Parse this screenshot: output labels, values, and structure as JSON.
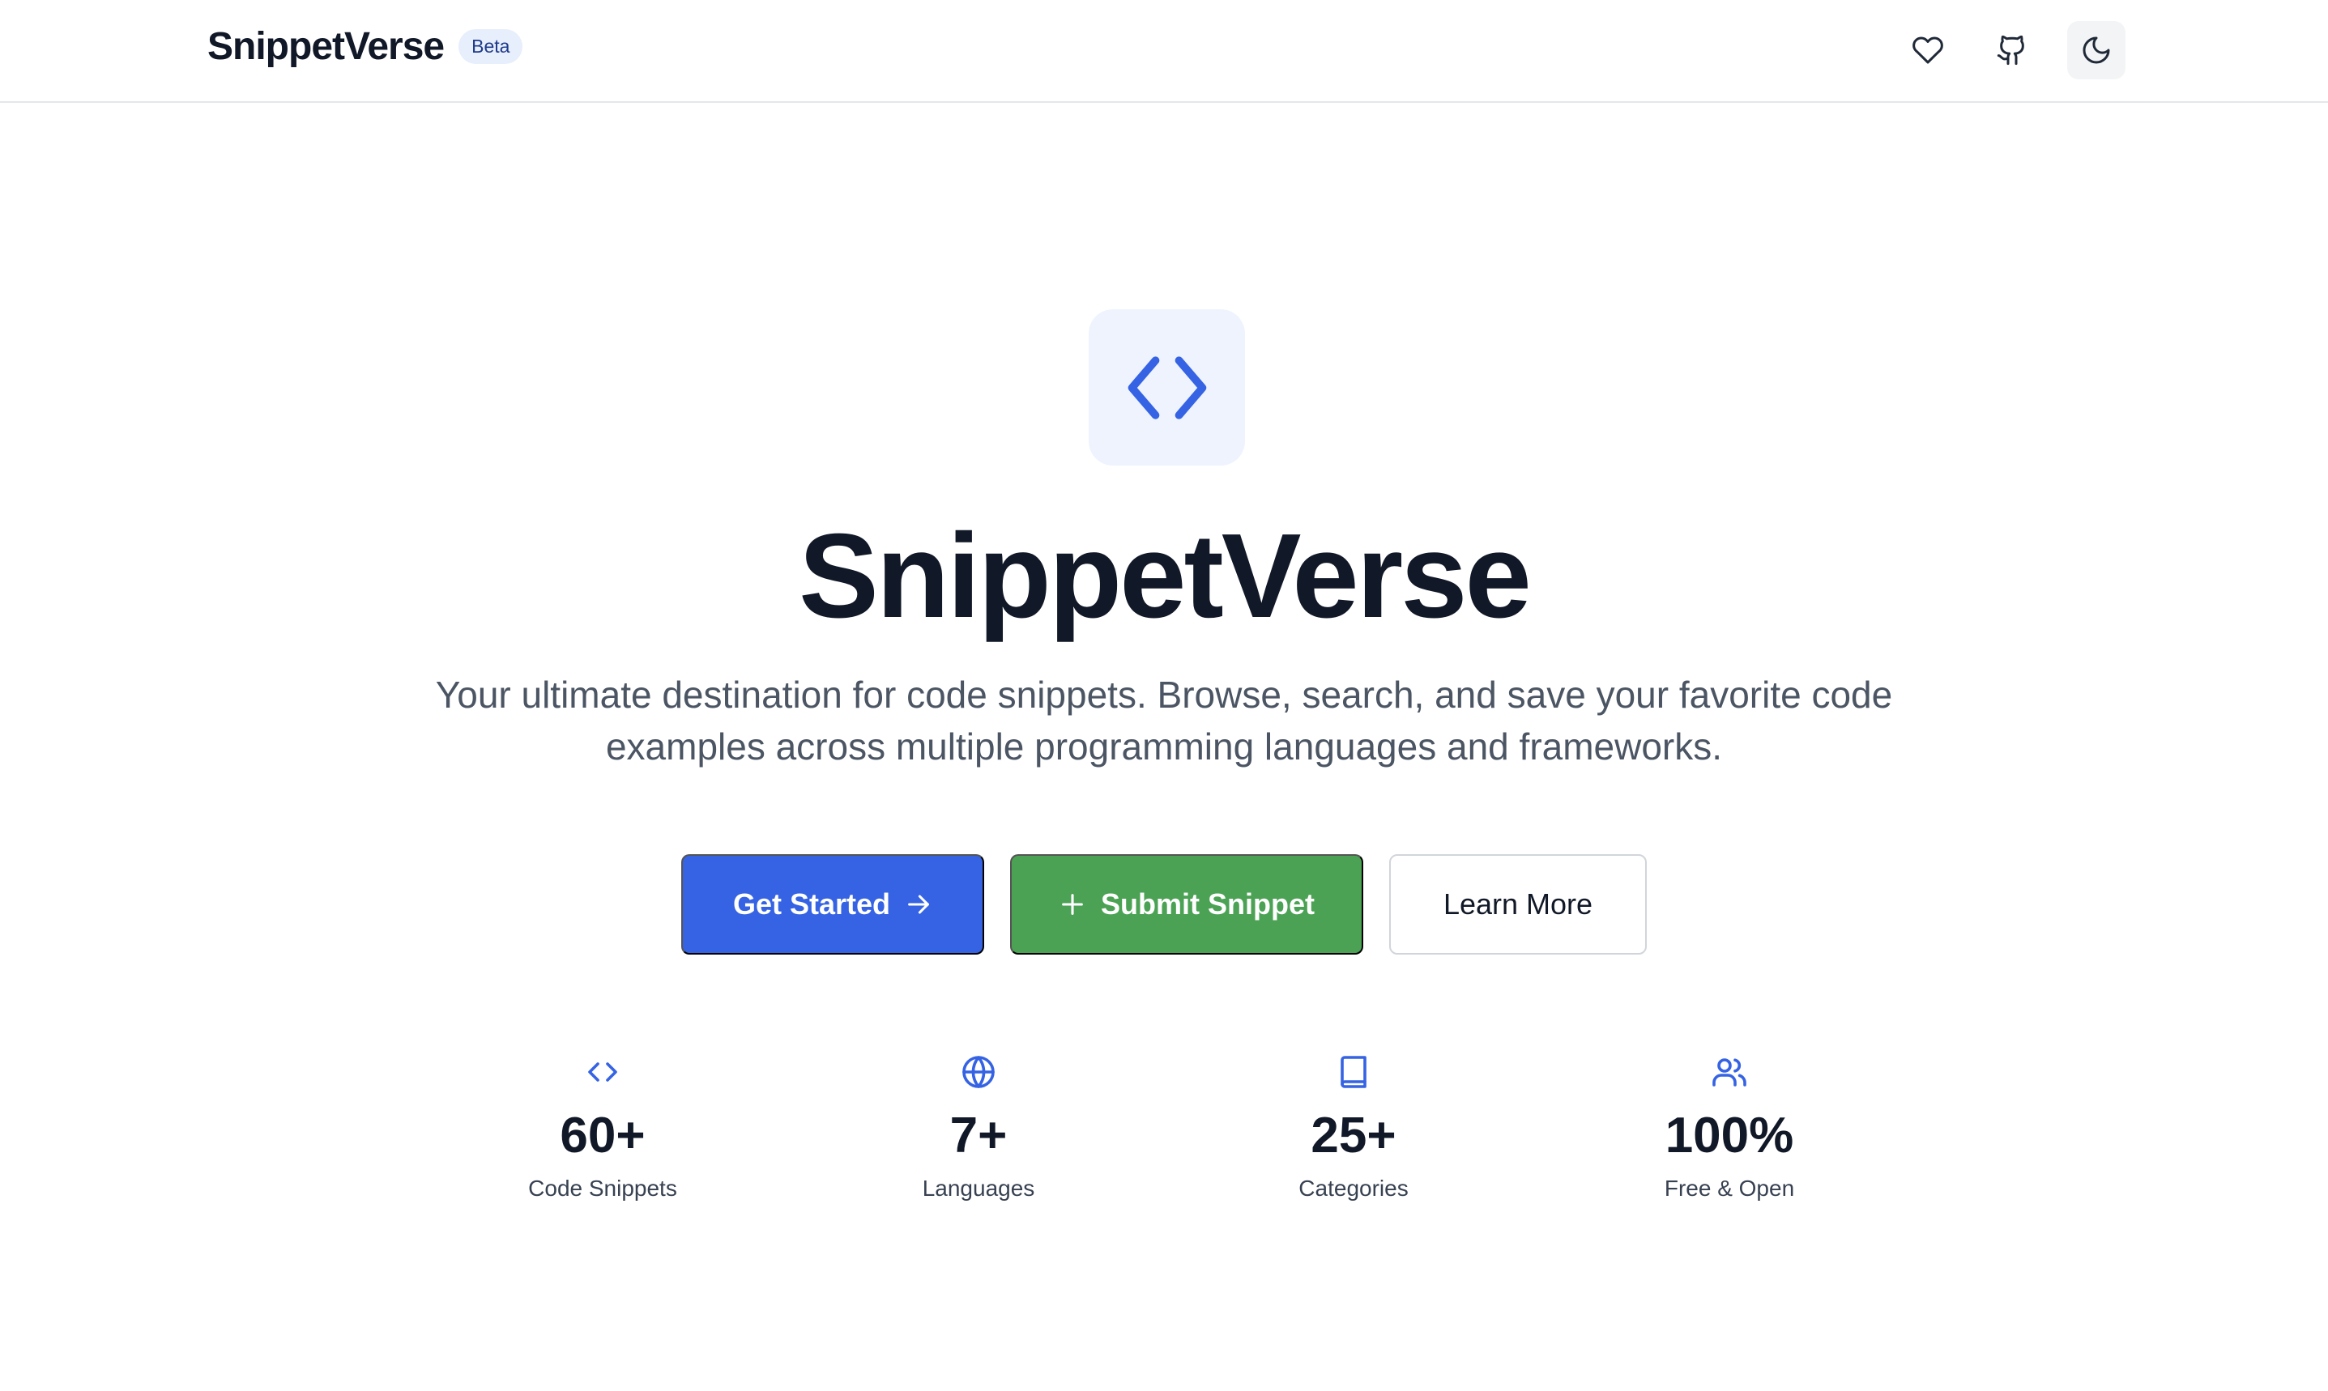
{
  "header": {
    "brand": "SnippetVerse",
    "badge": "Beta",
    "actions": [
      {
        "icon": "heart-icon"
      },
      {
        "icon": "github-icon"
      },
      {
        "icon": "moon-icon",
        "active": true
      }
    ]
  },
  "hero": {
    "logo_icon": "code-icon",
    "title": "SnippetVerse",
    "description": "Your ultimate destination for code snippets. Browse, search, and save your favorite code examples across multiple programming languages and frameworks.",
    "buttons": {
      "get_started": "Get Started",
      "submit_snippet": "Submit Snippet",
      "learn_more": "Learn More"
    }
  },
  "stats": [
    {
      "icon": "code-icon",
      "value": "60+",
      "label": "Code Snippets"
    },
    {
      "icon": "globe-icon",
      "value": "7+",
      "label": "Languages"
    },
    {
      "icon": "book-icon",
      "value": "25+",
      "label": "Categories"
    },
    {
      "icon": "users-icon",
      "value": "100%",
      "label": "Free & Open"
    }
  ],
  "colors": {
    "primary": "#3563e3",
    "success": "#4ba254",
    "text": "#111827",
    "muted": "#4b5563",
    "badge_bg": "#e7eefc",
    "logo_bg": "#eef3fe"
  }
}
